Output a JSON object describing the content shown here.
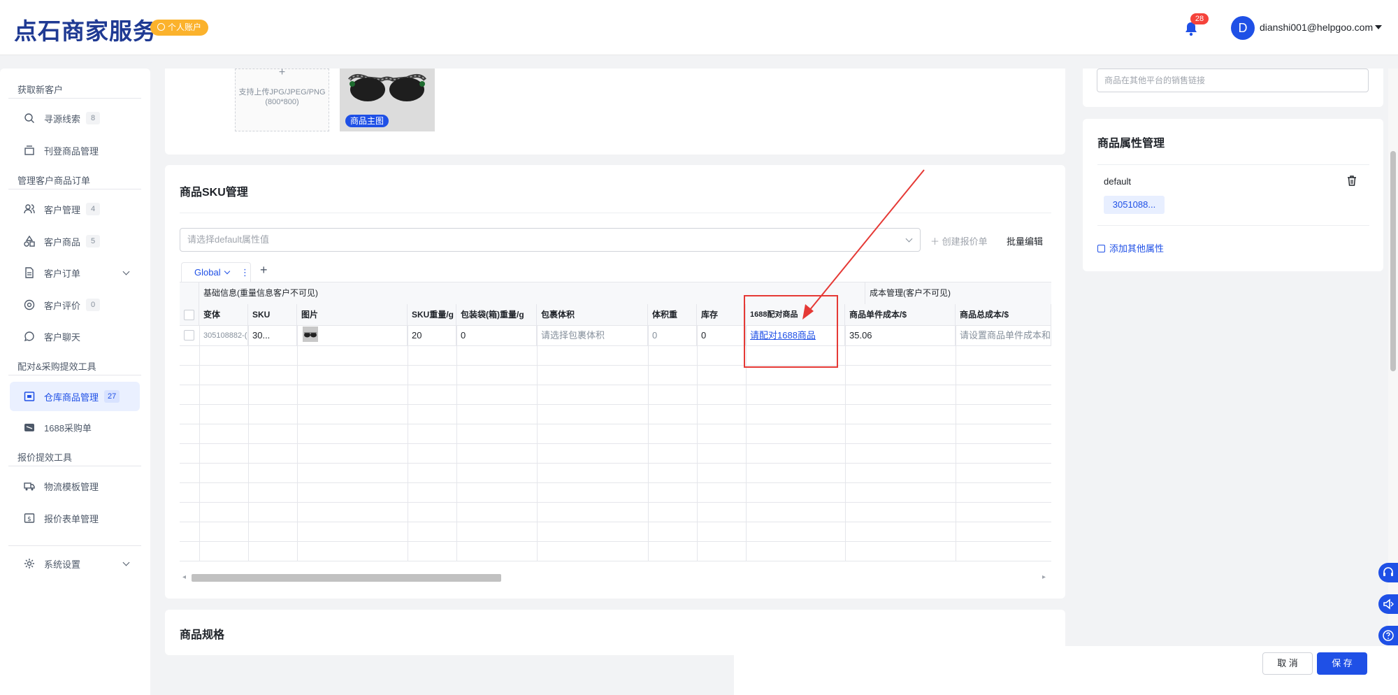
{
  "header": {
    "logo": "点石商家服务",
    "account_badge": "个人账户",
    "notification_count": "28",
    "avatar_initial": "D",
    "user_email": "dianshi001@helpgoo.com"
  },
  "sidebar": {
    "sections": [
      "获取新客户",
      "管理客户商品订单",
      "配对&采购提效工具",
      "报价提效工具"
    ],
    "items": [
      {
        "label": "寻源线索",
        "count": "8",
        "icon": "search-source-icon"
      },
      {
        "label": "刊登商品管理",
        "count": "",
        "icon": "listing-icon"
      },
      {
        "label": "客户管理",
        "count": "4",
        "icon": "users-icon"
      },
      {
        "label": "客户商品",
        "count": "5",
        "icon": "shapes-icon"
      },
      {
        "label": "客户订单",
        "count": "",
        "icon": "document-icon"
      },
      {
        "label": "客户评价",
        "count": "0",
        "icon": "review-icon"
      },
      {
        "label": "客户聊天",
        "count": "",
        "icon": "chat-icon"
      },
      {
        "label": "仓库商品管理",
        "count": "27",
        "icon": "warehouse-icon",
        "active": true
      },
      {
        "label": "1688采购单",
        "count": "",
        "icon": "purchase-icon"
      },
      {
        "label": "物流模板管理",
        "count": "",
        "icon": "truck-icon"
      },
      {
        "label": "报价表单管理",
        "count": "",
        "icon": "dollar-form-icon"
      },
      {
        "label": "系统设置",
        "count": "",
        "icon": "gear-icon"
      }
    ]
  },
  "image_upload": {
    "hint_line1": "支持上传JPG/JPEG/PNG",
    "hint_line2": "(800*800)",
    "main_image_tag": "商品主图"
  },
  "sku_section": {
    "title": "商品SKU管理",
    "attr_select_placeholder": "请选择default属性值",
    "create_quote": "创建报价单",
    "batch_edit": "批量编辑",
    "tab_label": "Global",
    "group_headers": {
      "basic": "基础信息(重量信息客户不可见)",
      "cost": "成本管理(客户不可见)"
    },
    "columns": [
      "变体",
      "SKU",
      "图片",
      "SKU重量/g",
      "包装袋(箱)重量/g",
      "包裹体积",
      "体积重",
      "库存",
      "1688配对商品",
      "商品单件成本/$",
      "商品总成本/$"
    ],
    "rows": [
      {
        "variant": "305108882-(",
        "sku": "30...",
        "weight": "20",
        "package_weight": "0",
        "package_volume": "请选择包裹体积",
        "volume_weight": "0",
        "stock": "0",
        "match_1688": "请配对1688商品",
        "unit_cost": "35.06",
        "total_cost": "请设置商品单件成本和库"
      }
    ]
  },
  "spec_section": {
    "title": "商品规格"
  },
  "right_panel": {
    "sales_link_placeholder": "商品在其他平台的销售链接",
    "attr_title": "商品属性管理",
    "attr_name": "default",
    "attr_value": "3051088...",
    "add_attr": "添加其他属性"
  },
  "actions": {
    "cancel": "取 消",
    "save": "保 存"
  },
  "colors": {
    "accent": "#1f50e6",
    "highlight": "#e53935",
    "badge": "#fbb22c"
  }
}
